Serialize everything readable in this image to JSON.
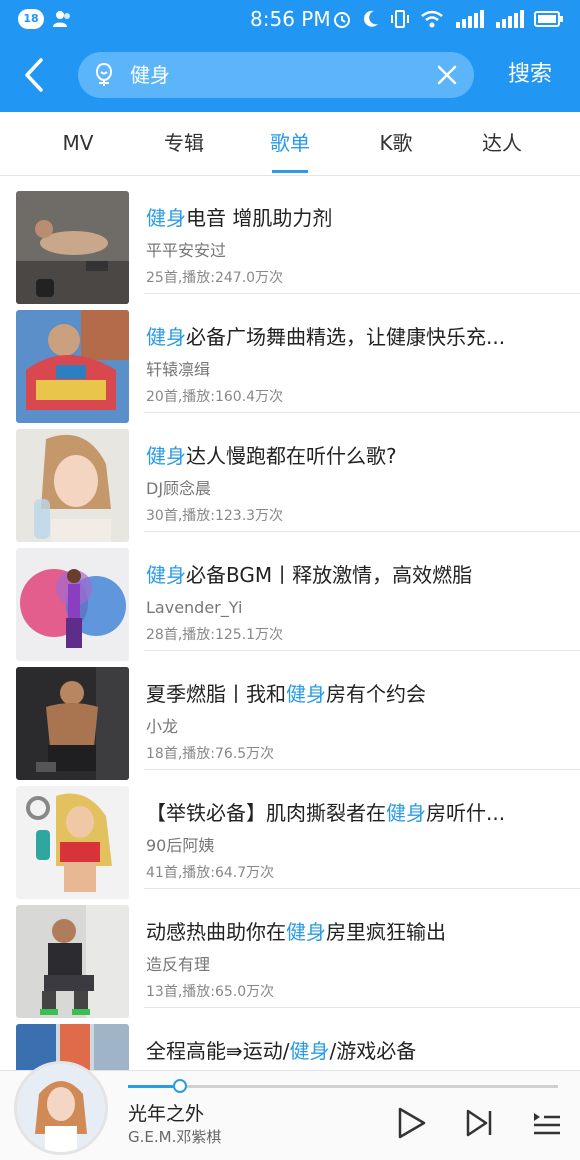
{
  "status_bar": {
    "notification_count": "18",
    "time": "8:56 PM"
  },
  "search": {
    "query": "健身",
    "button_label": "搜索"
  },
  "tabs": [
    {
      "label": "MV",
      "active": false
    },
    {
      "label": "专辑",
      "active": false
    },
    {
      "label": "歌单",
      "active": true
    },
    {
      "label": "K歌",
      "active": false
    },
    {
      "label": "达人",
      "active": false
    }
  ],
  "playlists": [
    {
      "title_parts": [
        {
          "text": "健身",
          "hl": true
        },
        {
          "text": "电音 增肌助力剂",
          "hl": false
        }
      ],
      "author": "平平安安过",
      "meta": "25首,播放:247.0万次"
    },
    {
      "title_parts": [
        {
          "text": "健身",
          "hl": true
        },
        {
          "text": "必备广场舞曲精选，让健康快乐充...",
          "hl": false
        }
      ],
      "author": "轩辕凛缉",
      "meta": "20首,播放:160.4万次"
    },
    {
      "title_parts": [
        {
          "text": "健身",
          "hl": true
        },
        {
          "text": "达人慢跑都在听什么歌?",
          "hl": false
        }
      ],
      "author": "DJ顾念晨",
      "meta": "30首,播放:123.3万次"
    },
    {
      "title_parts": [
        {
          "text": "健身",
          "hl": true
        },
        {
          "text": "必备BGM丨释放激情，高效燃脂",
          "hl": false
        }
      ],
      "author": "Lavender_Yi",
      "meta": "28首,播放:125.1万次"
    },
    {
      "title_parts": [
        {
          "text": "夏季燃脂丨我和",
          "hl": false
        },
        {
          "text": "健身",
          "hl": true
        },
        {
          "text": "房有个约会",
          "hl": false
        }
      ],
      "author": "小龙",
      "meta": "18首,播放:76.5万次"
    },
    {
      "title_parts": [
        {
          "text": "【举铁必备】肌肉撕裂者在",
          "hl": false
        },
        {
          "text": "健身",
          "hl": true
        },
        {
          "text": "房听什...",
          "hl": false
        }
      ],
      "author": "90后阿姨",
      "meta": "41首,播放:64.7万次"
    },
    {
      "title_parts": [
        {
          "text": "动感热曲助你在",
          "hl": false
        },
        {
          "text": "健身",
          "hl": true
        },
        {
          "text": "房里疯狂输出",
          "hl": false
        }
      ],
      "author": "造反有理",
      "meta": "13首,播放:65.0万次"
    },
    {
      "title_parts": [
        {
          "text": "全程高能⇛运动/",
          "hl": false
        },
        {
          "text": "健身",
          "hl": true
        },
        {
          "text": "/游戏必备",
          "hl": false
        }
      ],
      "author": "",
      "meta": ""
    }
  ],
  "player": {
    "song": "光年之外",
    "artist": "G.E.M.邓紫棋",
    "progress_fraction": 0.12
  },
  "colors": {
    "primary": "#2196f3",
    "highlight": "#2a9be6"
  }
}
